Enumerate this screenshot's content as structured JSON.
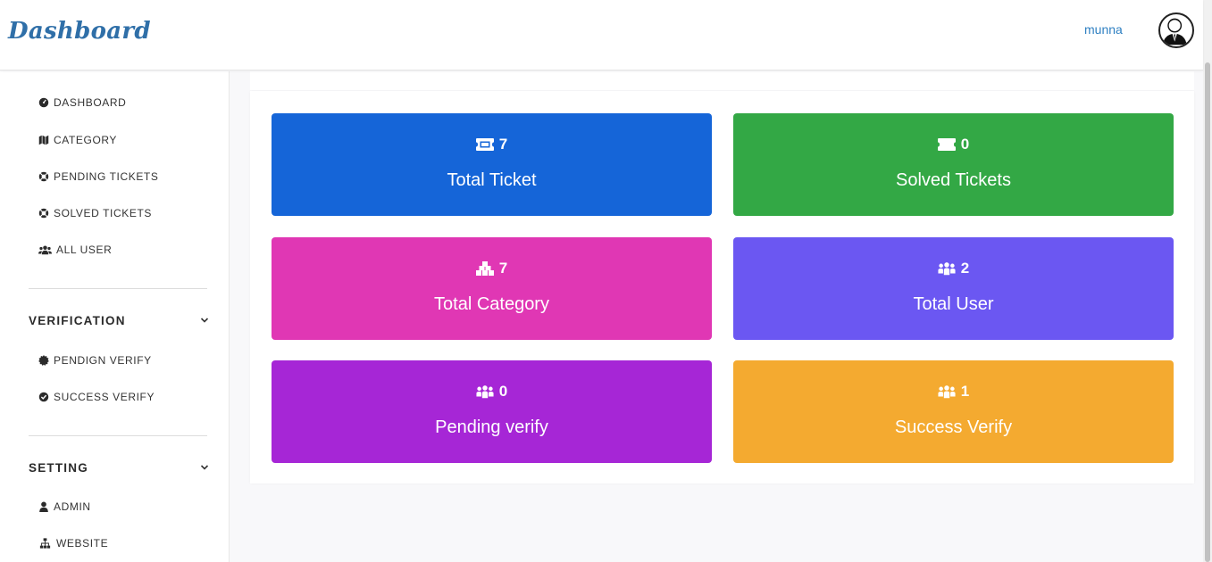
{
  "header": {
    "brand": "Dashboard",
    "username": "munna"
  },
  "sidebar": {
    "main_items": [
      {
        "label": "DASHBOARD",
        "icon": "speedometer-icon"
      },
      {
        "label": "CATEGORY",
        "icon": "map-icon"
      },
      {
        "label": "PENDING TICKETS",
        "icon": "lifebuoy-icon"
      },
      {
        "label": "SOLVED TICKETS",
        "icon": "lifebuoy-icon"
      },
      {
        "label": "ALL USER",
        "icon": "users-icon"
      }
    ],
    "verification": {
      "title": "VERIFICATION",
      "items": [
        {
          "label": "PENDIGN VERIFY",
          "icon": "certificate-icon"
        },
        {
          "label": "SUCCESS VERIFY",
          "icon": "check-circle-icon"
        }
      ]
    },
    "setting": {
      "title": "SETTING",
      "items": [
        {
          "label": "ADMIN",
          "icon": "user-icon"
        },
        {
          "label": "WEBSITE",
          "icon": "sitemap-icon"
        }
      ]
    }
  },
  "cards": [
    {
      "count": "7",
      "label": "Total Ticket",
      "icon": "ticket-icon",
      "color": "#1565d8"
    },
    {
      "count": "0",
      "label": "Solved Tickets",
      "icon": "ticket-solid-icon",
      "color": "#33a845"
    },
    {
      "count": "7",
      "label": "Total Category",
      "icon": "cubes-icon",
      "color": "#e037b4"
    },
    {
      "count": "2",
      "label": "Total User",
      "icon": "users-icon",
      "color": "#6b57f2"
    },
    {
      "count": "0",
      "label": "Pending verify",
      "icon": "users-icon",
      "color": "#a626d6"
    },
    {
      "count": "1",
      "label": "Success Verify",
      "icon": "users-icon",
      "color": "#f4aa30"
    }
  ]
}
